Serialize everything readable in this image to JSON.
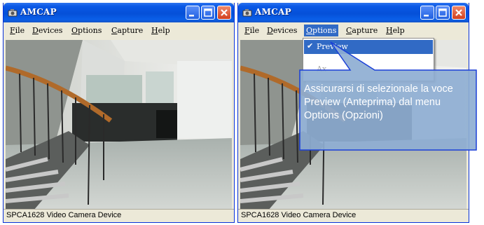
{
  "windows": [
    {
      "title": "AMCAP",
      "menu": {
        "file": "File",
        "devices": "Devices",
        "options": "Options",
        "capture": "Capture",
        "help": "Help"
      },
      "status": "SPCA1628 Video Camera Device"
    },
    {
      "title": "AMCAP",
      "menu": {
        "file": "File",
        "devices": "Devices",
        "options": "Options",
        "capture": "Capture",
        "help": "Help"
      },
      "status": "SPCA1628 Video Camera Device",
      "options_menu": {
        "preview_label": "Preview",
        "preview_checked": true,
        "disabled_item_label": "Ax"
      }
    }
  ],
  "callout": {
    "text": "Assicurarsi di selezionale la voce Preview (Anteprima) dal menu Options (Opzioni)",
    "fill_color": "#8eaed2",
    "border_color": "#1a3fd8"
  },
  "icons": [
    "app-icon",
    "minimize-icon",
    "maximize-icon",
    "close-icon",
    "check-icon"
  ]
}
